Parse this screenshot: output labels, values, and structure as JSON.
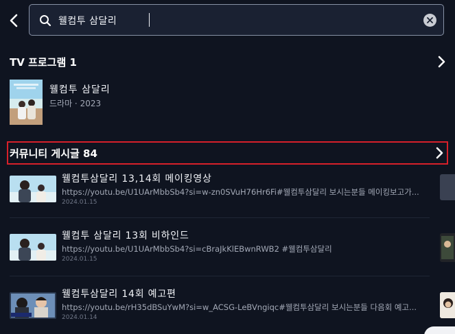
{
  "search": {
    "value": "웰컴투 삼달리"
  },
  "tv_section": {
    "title": "TV 프로그램 1",
    "items": [
      {
        "title": "웰컴투 삼달리",
        "meta": "드라마 · 2023"
      }
    ]
  },
  "community_section": {
    "title": "커뮤니티 게시글 84",
    "posts": [
      {
        "title": "웰컴투삼달리 13,14회 메이킹영상",
        "body": "https://youtu.be/U1UArMbbSb4?si=w-zn0SVuH76Hr6Fi#웰컴투삼달리 보시는분들 메이킹보고가...",
        "date": "2024.01.15"
      },
      {
        "title": "웰컴투 삼달리 13회 비하인드",
        "body": "https://youtu.be/U1UArMbbSb4?si=cBraJkKlEBwnRWB2 #웰컴투삼달리",
        "date": "2024.01.15"
      },
      {
        "title": "웰컴투삼달리 14회 예고편",
        "body": "https://youtu.be/rH35dBSuYwM?si=w_ACSG-LeBVngiqc#웰컴투삼달리 보시는분들 다음회 예고...",
        "date": "2024.01.14"
      }
    ]
  },
  "colors": {
    "background": "#0f1420",
    "highlight_border": "#d8202a",
    "search_bg": "#1a2132"
  }
}
